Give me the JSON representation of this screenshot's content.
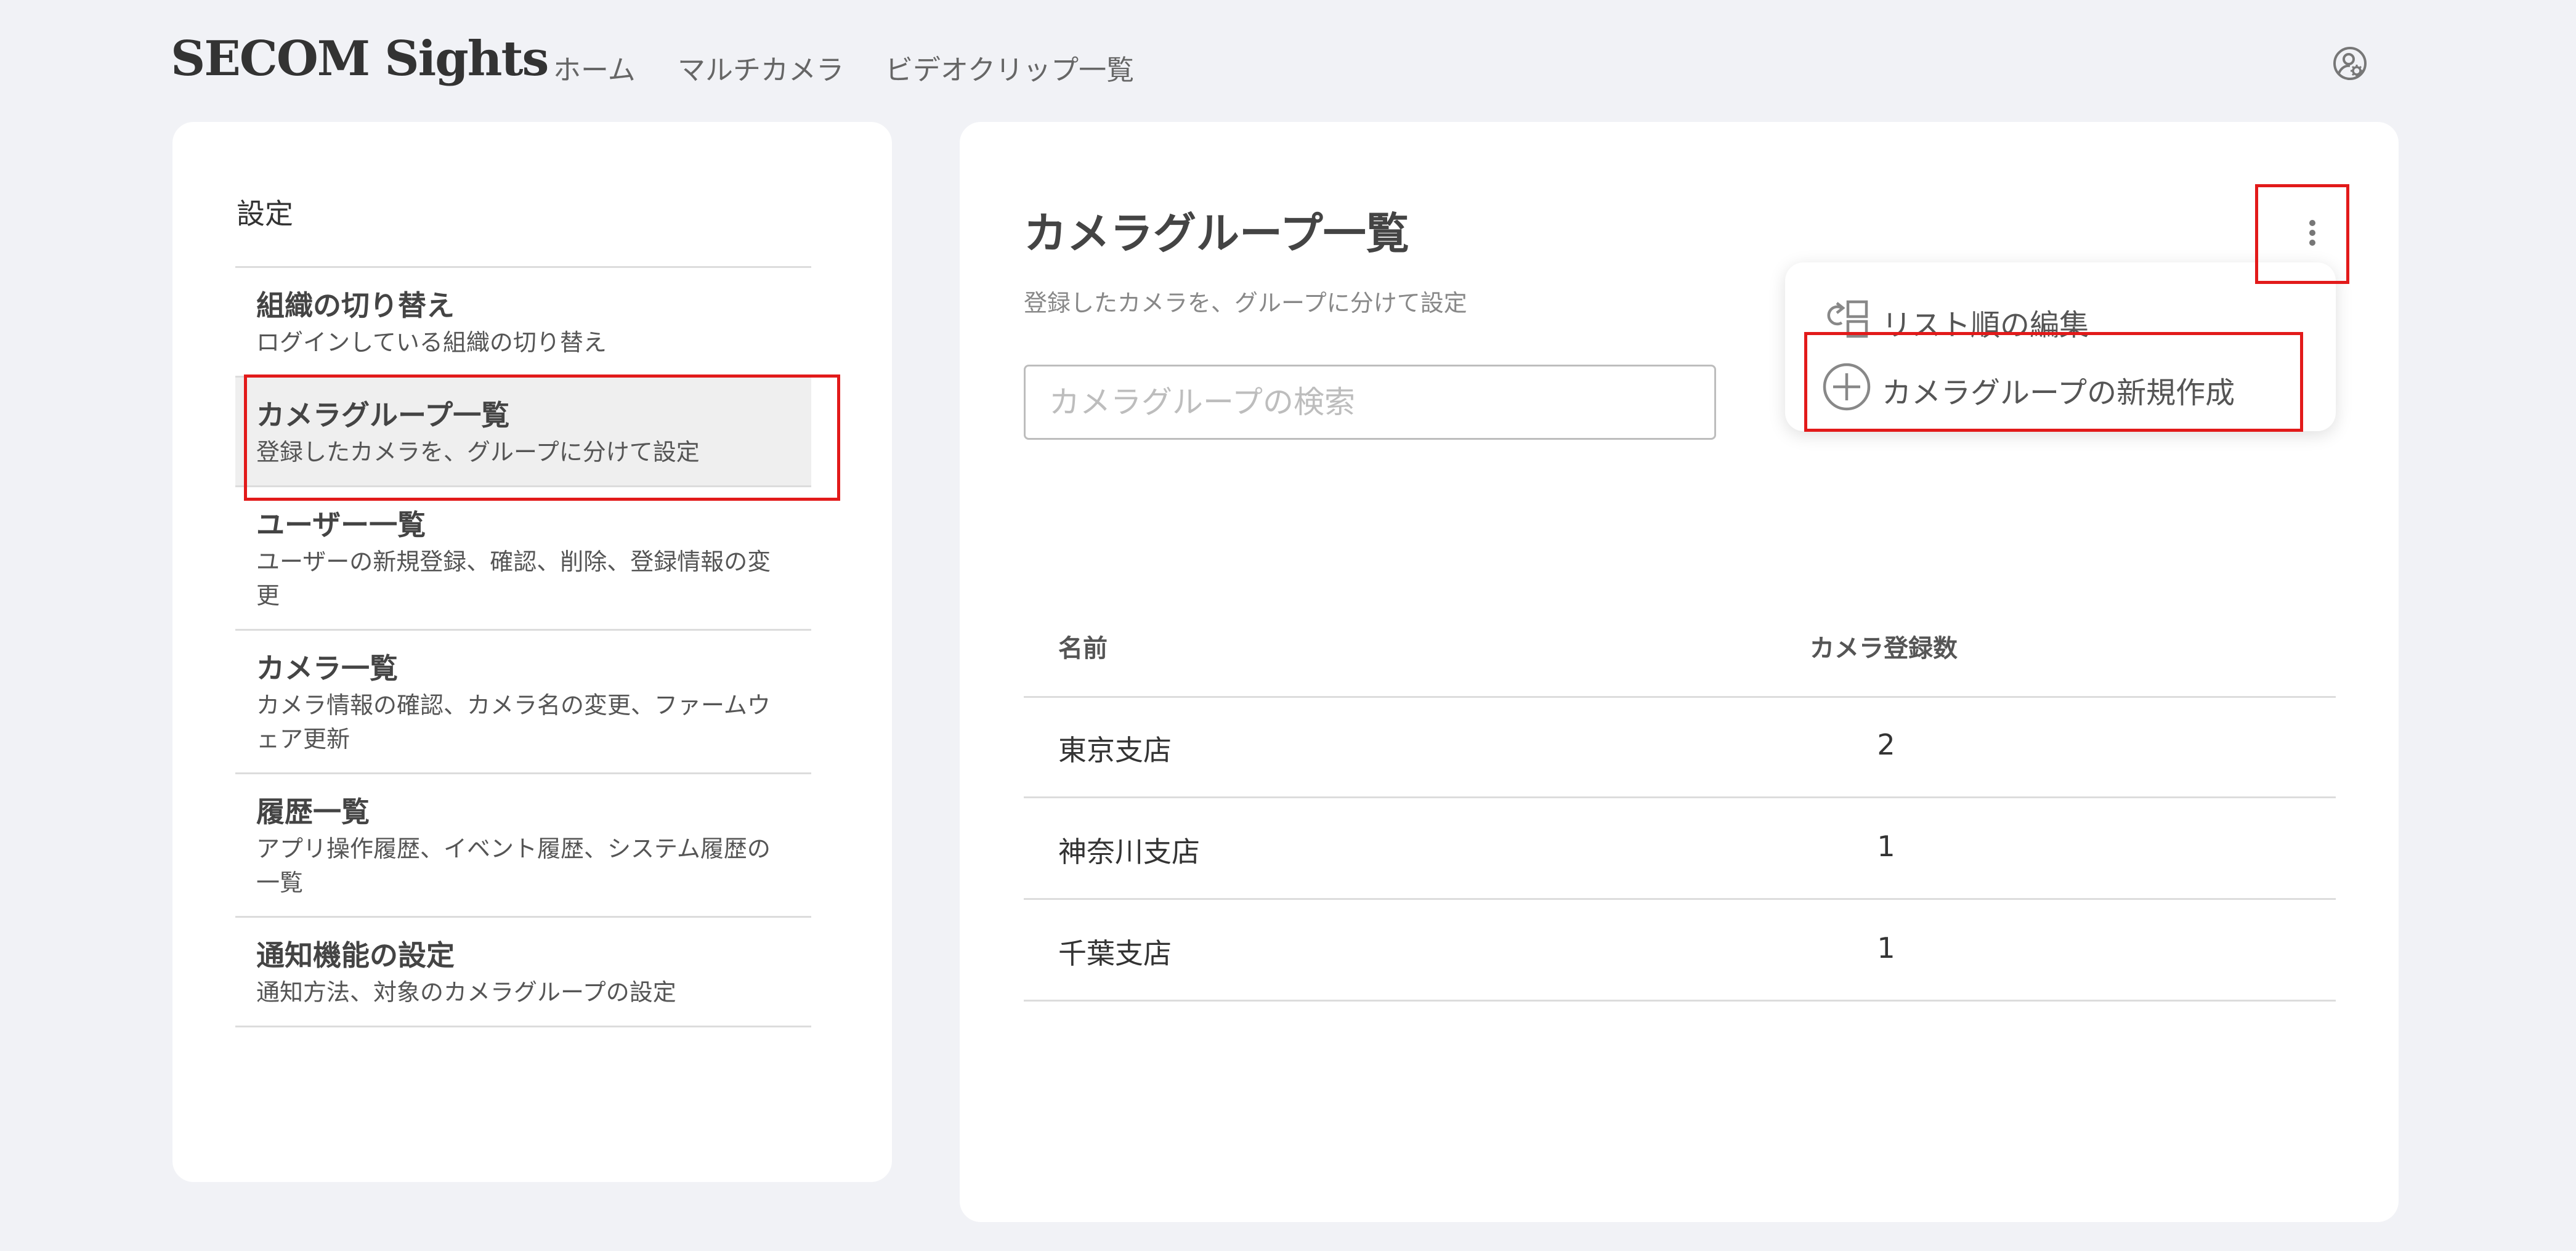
{
  "header": {
    "logo": "SECOM Sights",
    "nav": [
      "ホーム",
      "マルチカメラ",
      "ビデオクリップ一覧"
    ],
    "account_icon": "user-settings-icon"
  },
  "settings": {
    "title": "設定",
    "items": [
      {
        "title": "組織の切り替え",
        "desc": "ログインしている組織の切り替え",
        "active": false
      },
      {
        "title": "カメラグループ一覧",
        "desc": "登録したカメラを、グループに分けて設定",
        "active": true
      },
      {
        "title": "ユーザー一覧",
        "desc": "ユーザーの新規登録、確認、削除、登録情報の変更",
        "active": false
      },
      {
        "title": "カメラ一覧",
        "desc": "カメラ情報の確認、カメラ名の変更、ファームウェア更新",
        "active": false
      },
      {
        "title": "履歴一覧",
        "desc": "アプリ操作履歴、イベント履歴、システム履歴の一覧",
        "active": false
      },
      {
        "title": "通知機能の設定",
        "desc": "通知方法、対象のカメラグループの設定",
        "active": false
      }
    ]
  },
  "main": {
    "title": "カメラグループ一覧",
    "subtitle": "登録したカメラを、グループに分けて設定",
    "search": {
      "placeholder": "カメラグループの検索",
      "value": ""
    },
    "table": {
      "headers": [
        "名前",
        "カメラ登録数"
      ],
      "rows": [
        {
          "name": "東京支店",
          "count": "2"
        },
        {
          "name": "神奈川支店",
          "count": "1"
        },
        {
          "name": "千葉支店",
          "count": "1"
        }
      ]
    },
    "more_menu_icon": "kebab-icon",
    "menu": {
      "items": [
        {
          "label": "リスト順の編集",
          "icon": "reorder-icon"
        },
        {
          "label": "カメラグループの新規作成",
          "icon": "plus-circle-icon"
        }
      ]
    }
  },
  "colors": {
    "background": "#f1f2f6",
    "card": "#ffffff",
    "highlight": "#e21a1a",
    "active_item": "#efefef"
  }
}
